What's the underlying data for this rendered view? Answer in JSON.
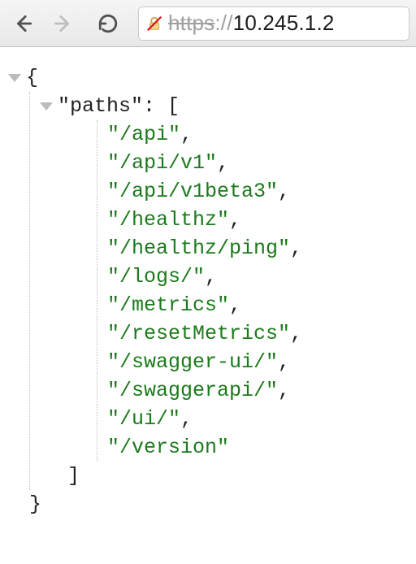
{
  "toolbar": {
    "back_enabled": true,
    "forward_enabled": false,
    "url_protocol": "https",
    "url_slashes": "://",
    "url_host": "10.245.1.2"
  },
  "json": {
    "root_open": "{",
    "root_close": "}",
    "key_label": "\"paths\"",
    "colon": ": ",
    "array_open": "[",
    "array_close": "]",
    "entries": [
      "/api",
      "/api/v1",
      "/api/v1beta3",
      "/healthz",
      "/healthz/ping",
      "/logs/",
      "/metrics",
      "/resetMetrics",
      "/swagger-ui/",
      "/swaggerapi/",
      "/ui/",
      "/version"
    ]
  }
}
